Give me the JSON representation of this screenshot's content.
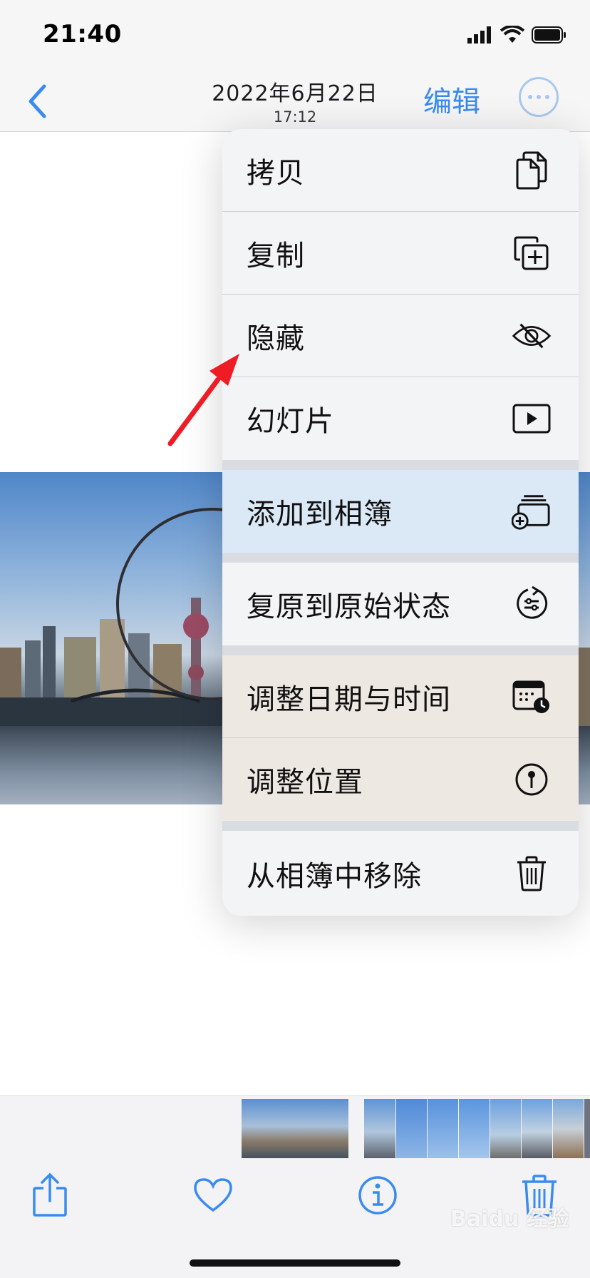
{
  "status_bar": {
    "time": "21:40"
  },
  "nav": {
    "date": "2022年6月22日",
    "time": "17:12",
    "edit_label": "编辑"
  },
  "menu": {
    "items": [
      {
        "label": "拷贝",
        "icon": "copy-doc-icon"
      },
      {
        "label": "复制",
        "icon": "duplicate-plus-icon"
      },
      {
        "label": "隐藏",
        "icon": "eye-slash-icon"
      },
      {
        "label": "幻灯片",
        "icon": "play-rectangle-icon"
      },
      {
        "label": "添加到相簿",
        "icon": "add-to-album-icon"
      },
      {
        "label": "复原到原始状态",
        "icon": "revert-original-icon"
      },
      {
        "label": "调整日期与时间",
        "icon": "calendar-clock-icon"
      },
      {
        "label": "调整位置",
        "icon": "location-pin-icon"
      },
      {
        "label": "从相簿中移除",
        "icon": "trash-icon"
      }
    ]
  },
  "toolbar": {
    "icons": [
      "share-icon",
      "heart-icon",
      "info-icon",
      "trash-icon"
    ]
  },
  "colors": {
    "accent": "#3a8bf0",
    "annotation_arrow": "#ee1c24",
    "highlight_row": "#dbe9f7"
  },
  "watermark": "Baidu 经验"
}
